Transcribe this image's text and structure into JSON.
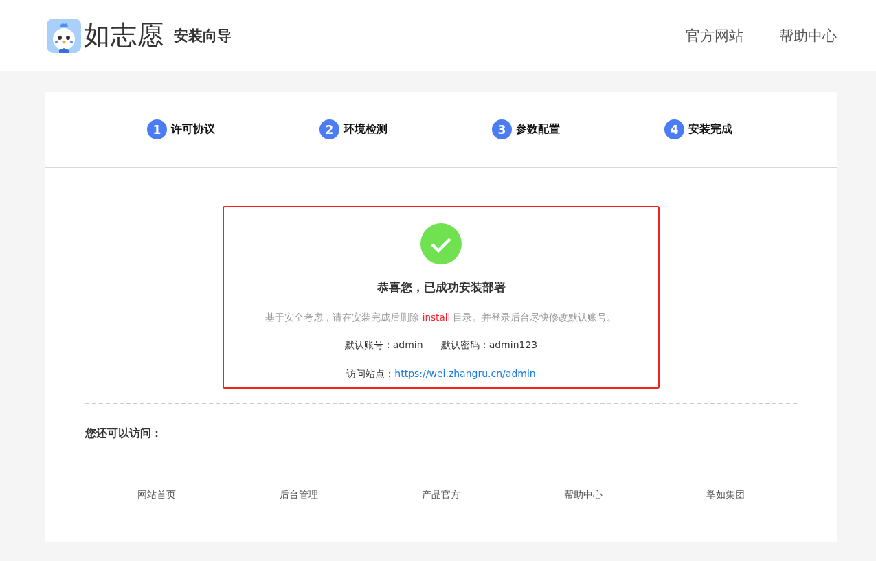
{
  "header": {
    "brand": "如志愿",
    "subtitle": "安装向导",
    "nav": [
      "官方网站",
      "帮助中心"
    ]
  },
  "steps": [
    {
      "number": "1",
      "label": "许可协议"
    },
    {
      "number": "2",
      "label": "环境检测"
    },
    {
      "number": "3",
      "label": "参数配置"
    },
    {
      "number": "4",
      "label": "安装完成"
    }
  ],
  "result": {
    "title": "恭喜您，已成功安装部署",
    "notice": "基于安全考虑，请在安装完成后删除 **install** 目录。并登录后台尽快修改默认账号。",
    "account_label": "默认账号：",
    "account": "admin",
    "password_label": "默认密码：",
    "password": "admin123",
    "site_label": "访问站点：",
    "site_url": "https://wei.zhangru.cn/admin"
  },
  "more": {
    "title": "您还可以访问：",
    "links": [
      "网站首页",
      "后台管理",
      "产品官方",
      "帮助中心",
      "掌如集团"
    ]
  }
}
